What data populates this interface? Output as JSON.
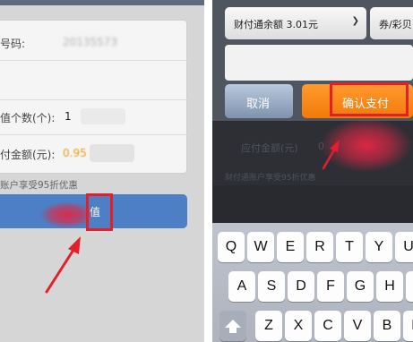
{
  "left": {
    "rows": [
      {
        "label": "号码:",
        "value": "20135573"
      },
      {
        "label": "",
        "value": ""
      },
      {
        "label": "值个数(个):",
        "value": "1"
      },
      {
        "label": "付金额(元):",
        "value": "0.95"
      }
    ],
    "hint": "账户享受95折优惠",
    "button_label": "值"
  },
  "right": {
    "balance_select": "财付通余额 3.01元",
    "coupon_select": "券/彩贝",
    "cancel_label": "取消",
    "confirm_label": "确认支付",
    "dim_amount_label": "应付金额(元)",
    "dim_amount_value": "0",
    "dim_hint": "财付通账户享受95折优惠"
  },
  "keyboard": {
    "row1": [
      "Q",
      "W",
      "E",
      "R",
      "T",
      "Y",
      "U",
      "I",
      "O"
    ],
    "row2": [
      "A",
      "S",
      "D",
      "F",
      "G",
      "H",
      "J",
      "K",
      "L"
    ],
    "row3": [
      "Z",
      "X",
      "C",
      "V",
      "B",
      "N",
      "M"
    ]
  },
  "colors": {
    "accent_blue": "#4c7fc4",
    "confirm_orange": "#f27a0a",
    "highlight_red": "#e2202b"
  },
  "icons": {
    "shift": "shift-arrow-icon",
    "select_chevron": "chevron-down-icon"
  }
}
